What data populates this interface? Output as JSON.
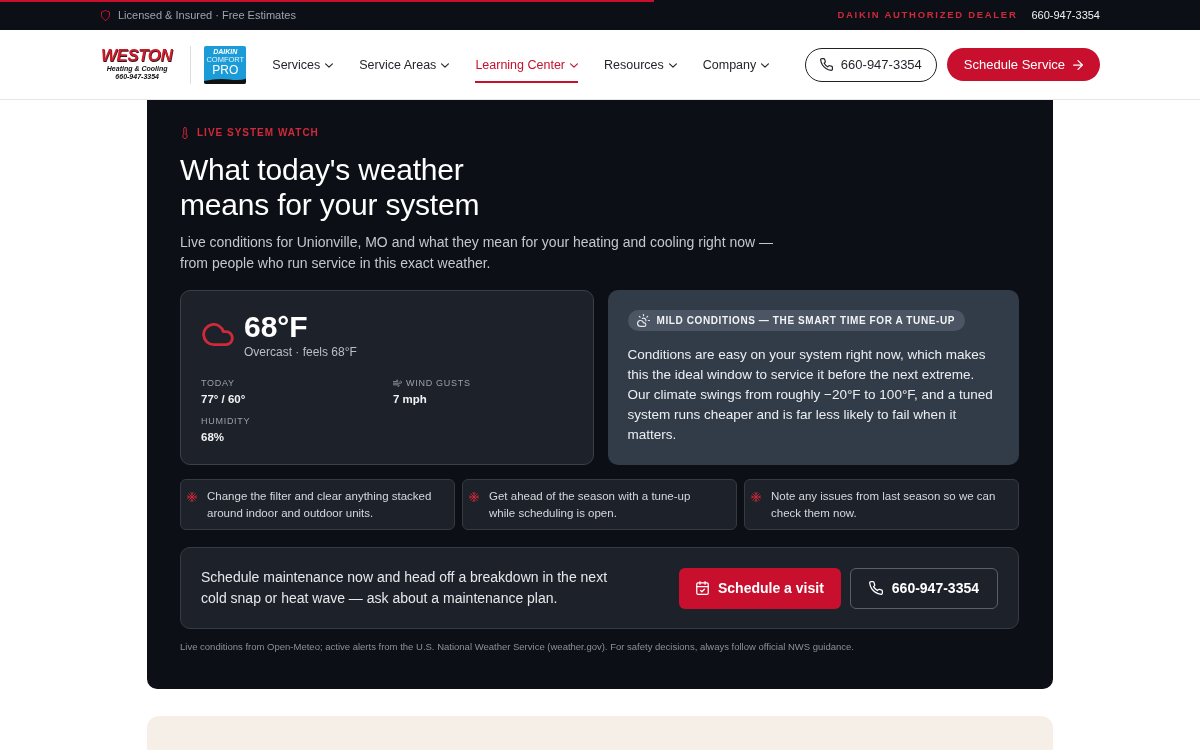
{
  "reading_progress": {
    "level": 0.545
  },
  "top_bar": {
    "trust_text": "Licensed & Insured · Free Estimates",
    "dealer_label": "DAIKIN AUTHORIZED DEALER",
    "phone": "660-947-3354"
  },
  "header": {
    "logo": {
      "wordmark": "WESTON",
      "tagline": "Heating & Cooling",
      "phone": "660-947-3354"
    },
    "partner_logo": {
      "brand": "DAIKIN",
      "line": "COMFORT",
      "mark": "PRO"
    },
    "nav": [
      {
        "label": "Services",
        "selected": false
      },
      {
        "label": "Service Areas",
        "selected": false
      },
      {
        "label": "Learning Center",
        "selected": true
      },
      {
        "label": "Resources",
        "selected": false
      },
      {
        "label": "Company",
        "selected": false
      }
    ],
    "phone_button": "660-947-3354",
    "cta_button": "Schedule Service"
  },
  "weather": {
    "eyebrow": "LIVE SYSTEM WATCH",
    "title": "What today's weather means for your system",
    "subtitle": "Live conditions for Unionville, MO and what they mean for your heating and cooling right now — from people who run service in this exact weather.",
    "current": {
      "temperature": "68°F",
      "summary": "Overcast · feels 68°F",
      "stats": [
        {
          "kind": "plain",
          "label": "TODAY",
          "value": "77° / 60°"
        },
        {
          "kind": "wind",
          "label": "WIND GUSTS",
          "value": "7 mph"
        },
        {
          "kind": "plain",
          "label": "HUMIDITY",
          "value": "68%"
        }
      ]
    },
    "advice": {
      "badge": "MILD CONDITIONS — THE SMART TIME FOR A TUNE-UP",
      "text": "Conditions are easy on your system right now, which makes this the ideal window to service it before the next extreme. Our climate swings from roughly −20°F to 100°F, and a tuned system runs cheaper and is far less likely to fail when it matters."
    },
    "tips": [
      "Change the filter and clear anything stacked around indoor and outdoor units.",
      "Get ahead of the season with a tune-up while scheduling is open.",
      "Note any issues from last season so we can check them now."
    ],
    "cta": {
      "text": "Schedule maintenance now and head off a breakdown in the next cold snap or heat wave — ask about a maintenance plan.",
      "primary_button": "Schedule a visit",
      "secondary_button": "660-947-3354"
    },
    "footnote": "Live conditions from Open-Meteo; active alerts from the U.S. National Weather Service (weather.gov). For safety decisions, always follow official NWS guidance."
  }
}
